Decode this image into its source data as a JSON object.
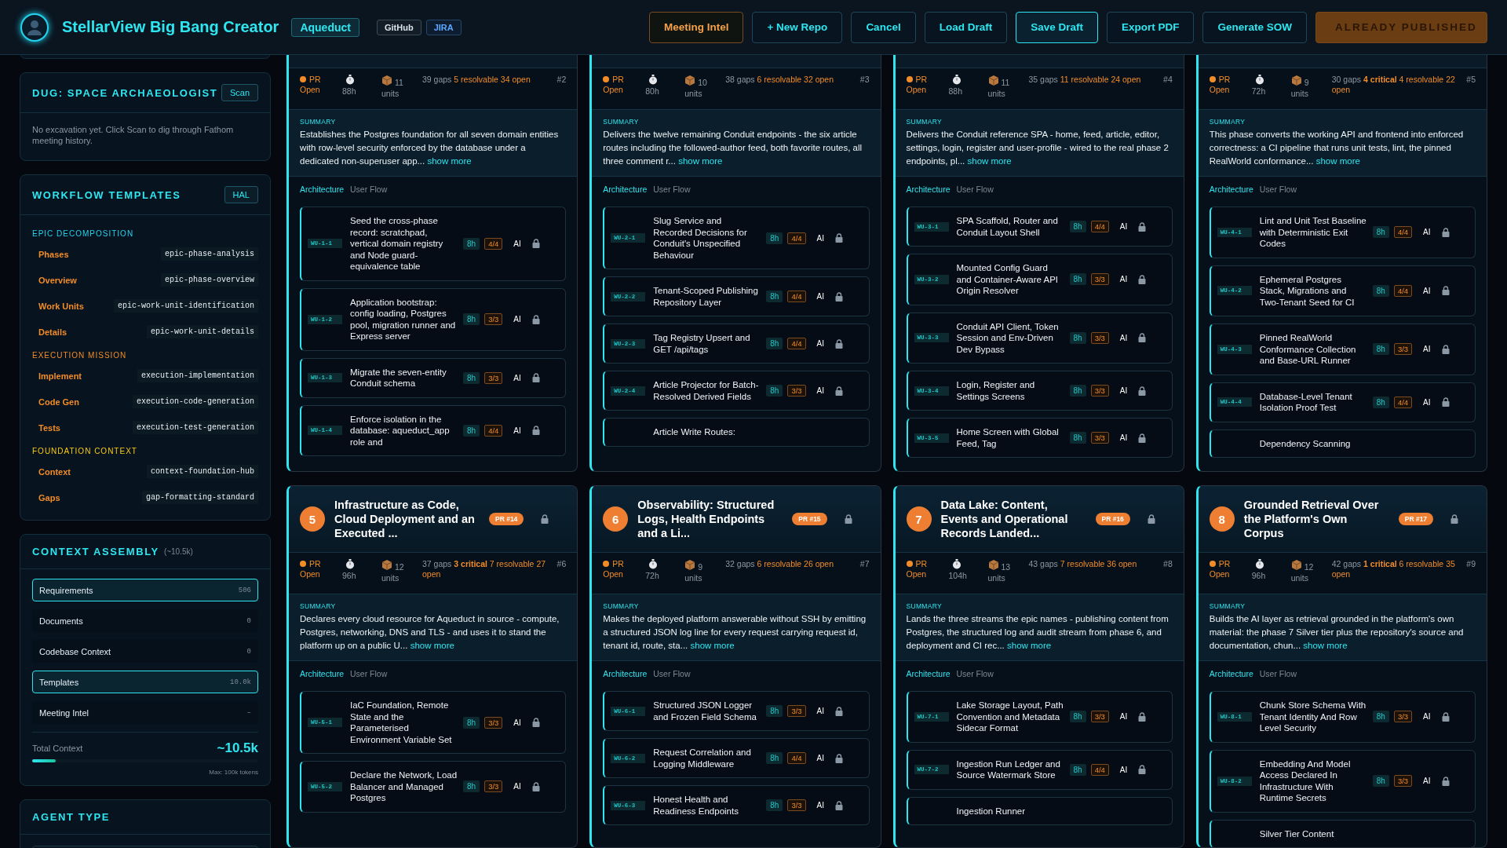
{
  "header": {
    "title": "StellarView Big Bang Creator",
    "project": "Aqueduct",
    "links": [
      {
        "label": "GitHub",
        "kind": "plain"
      },
      {
        "label": "JIRA",
        "kind": "blue"
      }
    ],
    "buttons": [
      {
        "label": "Meeting Intel",
        "kind": "accent"
      },
      {
        "label": "+ New Repo",
        "kind": "normal"
      },
      {
        "label": "Cancel",
        "kind": "normal"
      },
      {
        "label": "Load Draft",
        "kind": "normal"
      },
      {
        "label": "Save Draft",
        "kind": "primary"
      },
      {
        "label": "Export PDF",
        "kind": "normal"
      },
      {
        "label": "Generate SOW",
        "kind": "normal"
      },
      {
        "label": "ALREADY PUBLISHED",
        "kind": "published"
      }
    ]
  },
  "sidebar": {
    "dug": {
      "title": "DUG: SPACE ARCHAEOLOGIST",
      "button": "Scan",
      "message": "No excavation yet. Click Scan to dig through Fathom meeting history."
    },
    "templates": {
      "title": "WORKFLOW TEMPLATES",
      "button": "HAL",
      "groups": [
        {
          "name": "EPIC DECOMPOSITION",
          "color": "#22d3ee",
          "items": [
            {
              "label": "Phases",
              "value": "epic-phase-analysis"
            },
            {
              "label": "Overview",
              "value": "epic-phase-overview"
            },
            {
              "label": "Work Units",
              "value": "epic-work-unit-identification"
            },
            {
              "label": "Details",
              "value": "epic-work-unit-details"
            }
          ]
        },
        {
          "name": "EXECUTION MISSION",
          "color": "#f28c28",
          "items": [
            {
              "label": "Implement",
              "value": "execution-implementation"
            },
            {
              "label": "Code Gen",
              "value": "execution-code-generation"
            },
            {
              "label": "Tests",
              "value": "execution-test-generation"
            }
          ]
        },
        {
          "name": "FOUNDATION CONTEXT",
          "color": "#facc15",
          "items": [
            {
              "label": "Context",
              "value": "context-foundation-hub"
            },
            {
              "label": "Gaps",
              "value": "gap-formatting-standard"
            }
          ]
        }
      ]
    },
    "context": {
      "title": "CONTEXT ASSEMBLY",
      "estimate": "(~10.5k)",
      "items": [
        {
          "label": "Requirements",
          "value": "506",
          "selected": true
        },
        {
          "label": "Documents",
          "value": "0",
          "selected": false
        },
        {
          "label": "Codebase Context",
          "value": "0",
          "selected": false
        },
        {
          "label": "Templates",
          "value": "10.0k",
          "selected": true
        },
        {
          "label": "Meeting Intel",
          "value": "–",
          "selected": false
        }
      ],
      "total_label": "Total Context",
      "total": "~10.5k",
      "level": 0.105,
      "max": "Max: 100k tokens"
    },
    "agent_type": {
      "title": "AGENT TYPE"
    }
  },
  "phases": [
    {
      "status": "PR Open",
      "hours": "88h",
      "units": "11 units",
      "gaps_total": "39 gaps",
      "gaps_open": "5 resolvable 34 open",
      "number": "#2",
      "summary_label": "SUMMARY",
      "summary": "Establishes the Postgres foundation for all seven domain entities with row-level security enforced by the database under a dedicated non-superuser app...",
      "more": "show more",
      "tabs": [
        {
          "label": "Architecture",
          "selected": true
        },
        {
          "label": "User Flow",
          "selected": false
        }
      ],
      "work_units": [
        {
          "id": "WU-1-1",
          "title": "Seed the cross-phase record: scratchpad, vertical domain registry and Node guard-equivalence table",
          "hours": "8h",
          "tests": "4/4",
          "agent": "AI",
          "locked": true
        },
        {
          "id": "WU-1-2",
          "title": "Application bootstrap: config loading, Postgres pool, migration runner and Express server",
          "hours": "8h",
          "tests": "3/3",
          "agent": "AI",
          "locked": true
        },
        {
          "id": "WU-1-3",
          "title": "Migrate the seven-entity Conduit schema",
          "hours": "8h",
          "tests": "3/3",
          "agent": "AI",
          "locked": true
        },
        {
          "id": "WU-1-4",
          "title": "Enforce isolation in the database: aqueduct_app role and",
          "hours": "8h",
          "tests": "4/4",
          "agent": "AI",
          "locked": true
        }
      ]
    },
    {
      "status": "PR Open",
      "hours": "80h",
      "units": "10 units",
      "gaps_total": "38 gaps",
      "gaps_open": "6 resolvable 32 open",
      "number": "#3",
      "summary_label": "SUMMARY",
      "summary": "Delivers the twelve remaining Conduit endpoints - the six article routes including the followed-author feed, both favorite routes, all three comment r...",
      "more": "show more",
      "tabs": [
        {
          "label": "Architecture",
          "selected": true
        },
        {
          "label": "User Flow",
          "selected": false
        }
      ],
      "work_units": [
        {
          "id": "WU-2-1",
          "title": "Slug Service and Recorded Decisions for Conduit's Unspecified Behaviour",
          "hours": "8h",
          "tests": "4/4",
          "agent": "AI",
          "locked": true
        },
        {
          "id": "WU-2-2",
          "title": "Tenant-Scoped Publishing Repository Layer",
          "hours": "8h",
          "tests": "4/4",
          "agent": "AI",
          "locked": true
        },
        {
          "id": "WU-2-3",
          "title": "Tag Registry Upsert and GET /api/tags",
          "hours": "8h",
          "tests": "4/4",
          "agent": "AI",
          "locked": true
        },
        {
          "id": "WU-2-4",
          "title": "Article Projector for Batch-Resolved Derived Fields",
          "hours": "8h",
          "tests": "3/3",
          "agent": "AI",
          "locked": true
        },
        {
          "title": "Article Write Routes:"
        }
      ]
    },
    {
      "status": "PR Open",
      "hours": "88h",
      "units": "11 units",
      "gaps_total": "35 gaps",
      "gaps_open": "11 resolvable 24 open",
      "number": "#4",
      "summary_label": "SUMMARY",
      "summary": "Delivers the Conduit reference SPA - home, feed, article, editor, settings, login, register and user-profile - wired to the real phase 2 endpoints, pl...",
      "more": "show more",
      "tabs": [
        {
          "label": "Architecture",
          "selected": true
        },
        {
          "label": "User Flow",
          "selected": false
        }
      ],
      "work_units": [
        {
          "id": "WU-3-1",
          "title": "SPA Scaffold, Router and Conduit Layout Shell",
          "hours": "8h",
          "tests": "4/4",
          "agent": "AI",
          "locked": true
        },
        {
          "id": "WU-3-2",
          "title": "Mounted Config Guard and Container-Aware API Origin Resolver",
          "hours": "8h",
          "tests": "3/3",
          "agent": "AI",
          "locked": true
        },
        {
          "id": "WU-3-3",
          "title": "Conduit API Client, Token Session and Env-Driven Dev Bypass",
          "hours": "8h",
          "tests": "3/3",
          "agent": "AI",
          "locked": true
        },
        {
          "id": "WU-3-4",
          "title": "Login, Register and Settings Screens",
          "hours": "8h",
          "tests": "3/3",
          "agent": "AI",
          "locked": true
        },
        {
          "id": "WU-3-5",
          "title": "Home Screen with Global Feed, Tag",
          "hours": "8h",
          "tests": "3/3",
          "agent": "AI",
          "locked": true
        }
      ]
    },
    {
      "status": "PR Open",
      "hours": "72h",
      "units": "9 units",
      "gaps_total": "30 gaps",
      "gaps_critical": "4 critical",
      "gaps_open": "4 resolvable 22 open",
      "number": "#5",
      "summary_label": "SUMMARY",
      "summary": "This phase converts the working API and frontend into enforced correctness: a CI pipeline that runs unit tests, lint, the pinned RealWorld conformance...",
      "more": "show more",
      "tabs": [
        {
          "label": "Architecture",
          "selected": true
        },
        {
          "label": "User Flow",
          "selected": false
        }
      ],
      "work_units": [
        {
          "id": "WU-4-1",
          "title": "Lint and Unit Test Baseline with Deterministic Exit Codes",
          "hours": "8h",
          "tests": "4/4",
          "agent": "AI",
          "locked": true
        },
        {
          "id": "WU-4-2",
          "title": "Ephemeral Postgres Stack, Migrations and Two-Tenant Seed for CI",
          "hours": "8h",
          "tests": "4/4",
          "agent": "AI",
          "locked": true
        },
        {
          "id": "WU-4-3",
          "title": "Pinned RealWorld Conformance Collection and Base-URL Runner",
          "hours": "8h",
          "tests": "3/3",
          "agent": "AI",
          "locked": true
        },
        {
          "id": "WU-4-4",
          "title": "Database-Level Tenant Isolation Proof Test",
          "hours": "8h",
          "tests": "4/4",
          "agent": "AI",
          "locked": true
        },
        {
          "title": "Dependency Scanning"
        }
      ]
    },
    {
      "header": {
        "step": "5",
        "title": "Infrastructure as Code, Cloud Deployment and an Executed ...",
        "pr": "PR #14",
        "locked": true
      },
      "status": "PR Open",
      "hours": "96h",
      "units": "12 units",
      "gaps_total": "37 gaps",
      "gaps_critical": "3 critical",
      "gaps_open": "7 resolvable 27 open",
      "number": "#6",
      "summary_label": "SUMMARY",
      "summary": "Declares every cloud resource for Aqueduct in source - compute, Postgres, networking, DNS and TLS - and uses it to stand the platform up on a public U...",
      "more": "show more",
      "tabs": [
        {
          "label": "Architecture",
          "selected": true
        },
        {
          "label": "User Flow",
          "selected": false
        }
      ],
      "work_units": [
        {
          "id": "WU-5-1",
          "title": "IaC Foundation, Remote State and the Parameterised Environment Variable Set",
          "hours": "8h",
          "tests": "3/3",
          "agent": "AI",
          "locked": true
        },
        {
          "id": "WU-5-2",
          "title": "Declare the Network, Load Balancer and Managed Postgres",
          "hours": "8h",
          "tests": "3/3",
          "agent": "AI",
          "locked": true
        }
      ]
    },
    {
      "header": {
        "step": "6",
        "title": "Observability: Structured Logs, Health Endpoints and a Li...",
        "pr": "PR #15",
        "locked": true
      },
      "status": "PR Open",
      "hours": "72h",
      "units": "9 units",
      "gaps_total": "32 gaps",
      "gaps_open": "6 resolvable 26 open",
      "number": "#7",
      "summary_label": "SUMMARY",
      "summary": "Makes the deployed platform answerable without SSH by emitting a structured JSON log line for every request carrying request id, tenant id, route, sta...",
      "more": "show more",
      "tabs": [
        {
          "label": "Architecture",
          "selected": true
        },
        {
          "label": "User Flow",
          "selected": false
        }
      ],
      "work_units": [
        {
          "id": "WU-6-1",
          "title": "Structured JSON Logger and Frozen Field Schema",
          "hours": "8h",
          "tests": "3/3",
          "agent": "AI",
          "locked": true
        },
        {
          "id": "WU-6-2",
          "title": "Request Correlation and Logging Middleware",
          "hours": "8h",
          "tests": "4/4",
          "agent": "AI",
          "locked": true
        },
        {
          "id": "WU-6-3",
          "title": "Honest Health and Readiness Endpoints",
          "hours": "8h",
          "tests": "3/3",
          "agent": "AI",
          "locked": true
        }
      ]
    },
    {
      "header": {
        "step": "7",
        "title": "Data Lake: Content, Events and Operational Records Landed...",
        "pr": "PR #16",
        "locked": true
      },
      "status": "PR Open",
      "hours": "104h",
      "units": "13 units",
      "gaps_total": "43 gaps",
      "gaps_open": "7 resolvable 36 open",
      "number": "#8",
      "summary_label": "SUMMARY",
      "summary": "Lands the three streams the epic names - publishing content from Postgres, the structured log and audit stream from phase 6, and deployment and CI rec...",
      "more": "show more",
      "tabs": [
        {
          "label": "Architecture",
          "selected": true
        },
        {
          "label": "User Flow",
          "selected": false
        }
      ],
      "work_units": [
        {
          "id": "WU-7-1",
          "title": "Lake Storage Layout, Path Convention and Metadata Sidecar Format",
          "hours": "8h",
          "tests": "3/3",
          "agent": "AI",
          "locked": true
        },
        {
          "id": "WU-7-2",
          "title": "Ingestion Run Ledger and Source Watermark Store",
          "hours": "8h",
          "tests": "4/4",
          "agent": "AI",
          "locked": true
        },
        {
          "title": "Ingestion Runner"
        }
      ]
    },
    {
      "header": {
        "step": "8",
        "title": "Grounded Retrieval Over the Platform's Own Corpus",
        "pr": "PR #17",
        "locked": true
      },
      "status": "PR Open",
      "hours": "96h",
      "units": "12 units",
      "gaps_total": "42 gaps",
      "gaps_critical": "1 critical",
      "gaps_open": "6 resolvable 35 open",
      "number": "#9",
      "summary_label": "SUMMARY",
      "summary": "Builds the AI layer as retrieval grounded in the platform's own material: the phase 7 Silver tier plus the repository's source and documentation, chun...",
      "more": "show more",
      "tabs": [
        {
          "label": "Architecture",
          "selected": true
        },
        {
          "label": "User Flow",
          "selected": false
        }
      ],
      "work_units": [
        {
          "id": "WU-8-1",
          "title": "Chunk Store Schema With Tenant Identity And Row Level Security",
          "hours": "8h",
          "tests": "3/3",
          "agent": "AI",
          "locked": true
        },
        {
          "id": "WU-8-2",
          "title": "Embedding And Model Access Declared In Infrastructure With Runtime Secrets",
          "hours": "8h",
          "tests": "3/3",
          "agent": "AI",
          "locked": true
        },
        {
          "title": "Silver Tier Content"
        }
      ]
    }
  ]
}
